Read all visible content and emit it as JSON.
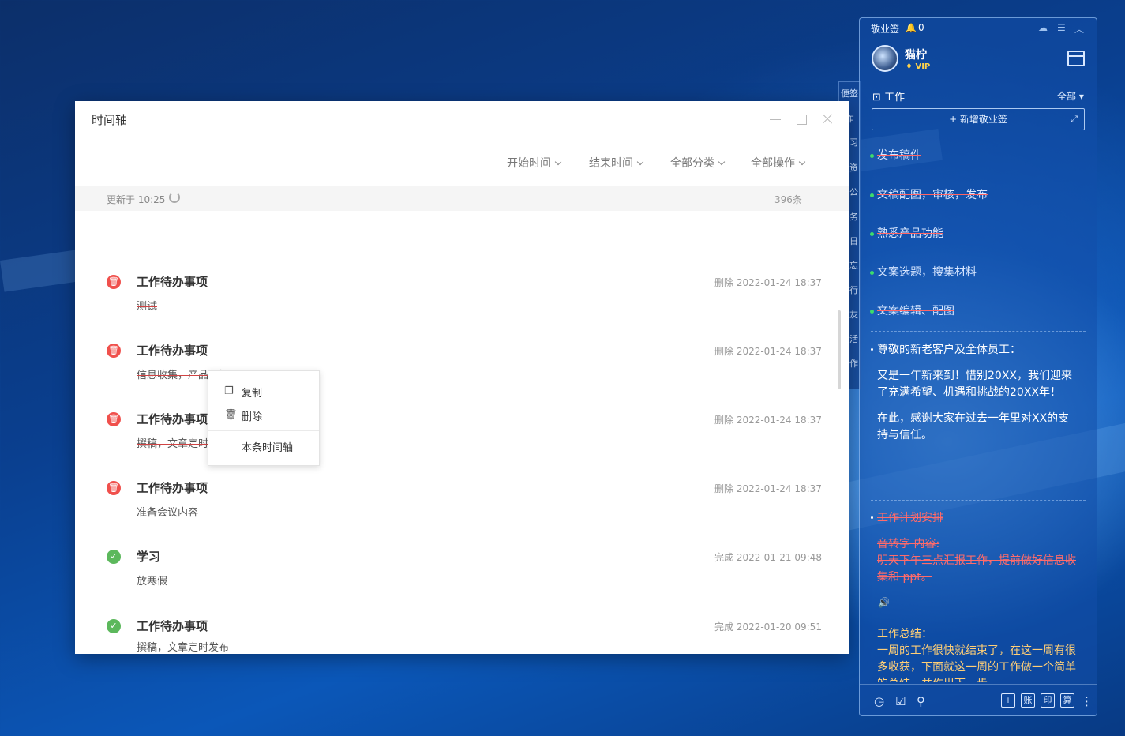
{
  "timeline": {
    "title": "时间轴",
    "filters": [
      "开始时间",
      "结束时间",
      "全部分类",
      "全部操作"
    ],
    "updated": "更新于 10:25",
    "count": "396条",
    "items": [
      {
        "title": "工作待办事项",
        "text": "测试",
        "meta": "删除 2022-01-24 18:37",
        "status": "deleted"
      },
      {
        "title": "工作待办事项",
        "text": "信息收集，产品了解",
        "meta": "删除 2022-01-24 18:37",
        "status": "deleted"
      },
      {
        "title": "工作待办事项",
        "text": "撰稿，文章定时",
        "meta": "删除 2022-01-24 18:37",
        "status": "deleted"
      },
      {
        "title": "工作待办事项",
        "text": "准备会议内容",
        "meta": "删除 2022-01-24 18:37",
        "status": "deleted"
      },
      {
        "title": "学习",
        "text": "放寒假",
        "meta": "完成 2022-01-21 09:48",
        "status": "done"
      },
      {
        "title": "工作待办事项",
        "text": "撰稿，文章定时发布",
        "meta": "完成 2022-01-20 09:51",
        "status": "done"
      }
    ],
    "context_menu": {
      "copy": "复制",
      "delete": "删除",
      "this_timeline": "本条时间轴"
    }
  },
  "side_strip": {
    "tabs": [
      "便签",
      "作",
      "学习",
      "投资",
      "办公",
      "家务",
      "节日",
      "备忘",
      "旅行",
      "朋友",
      "生活",
      "工作"
    ]
  },
  "notes_app": {
    "app_name": "敬业签",
    "bell_count": "0",
    "user": "猫柠",
    "vip": "VIP",
    "section": "工作",
    "filter": "全部",
    "add_label": "+ 新增敬业签",
    "notes": {
      "n1": "发布稿件",
      "n2": "文稿配图，审核，发布",
      "n3": "熟悉产品功能",
      "n4": "文案选题，搜集材料",
      "n5": "文案编辑、配图",
      "n6_l1": "尊敬的新老客户及全体员工：",
      "n6_l2": "又是一年新来到！惜别20XX，我们迎来了充满希望、机遇和挑战的20XX年！",
      "n6_l3": "在此，感谢大家在过去一年里对XX的支持与信任。",
      "n7_l1": "工作计划安排",
      "n7_l2": "音转字 内容:",
      "n7_l3": "明天下午三点汇报工作，提前做好信息收集和 ppt。",
      "n8_l1": "工作总结：",
      "n8_l2": "一周的工作很快就结束了，在这一周有很多收获，下面就这一周的工作做一个简单的总结，并作出下一步"
    },
    "bottom_boxes": [
      "账",
      "印",
      "算"
    ]
  }
}
